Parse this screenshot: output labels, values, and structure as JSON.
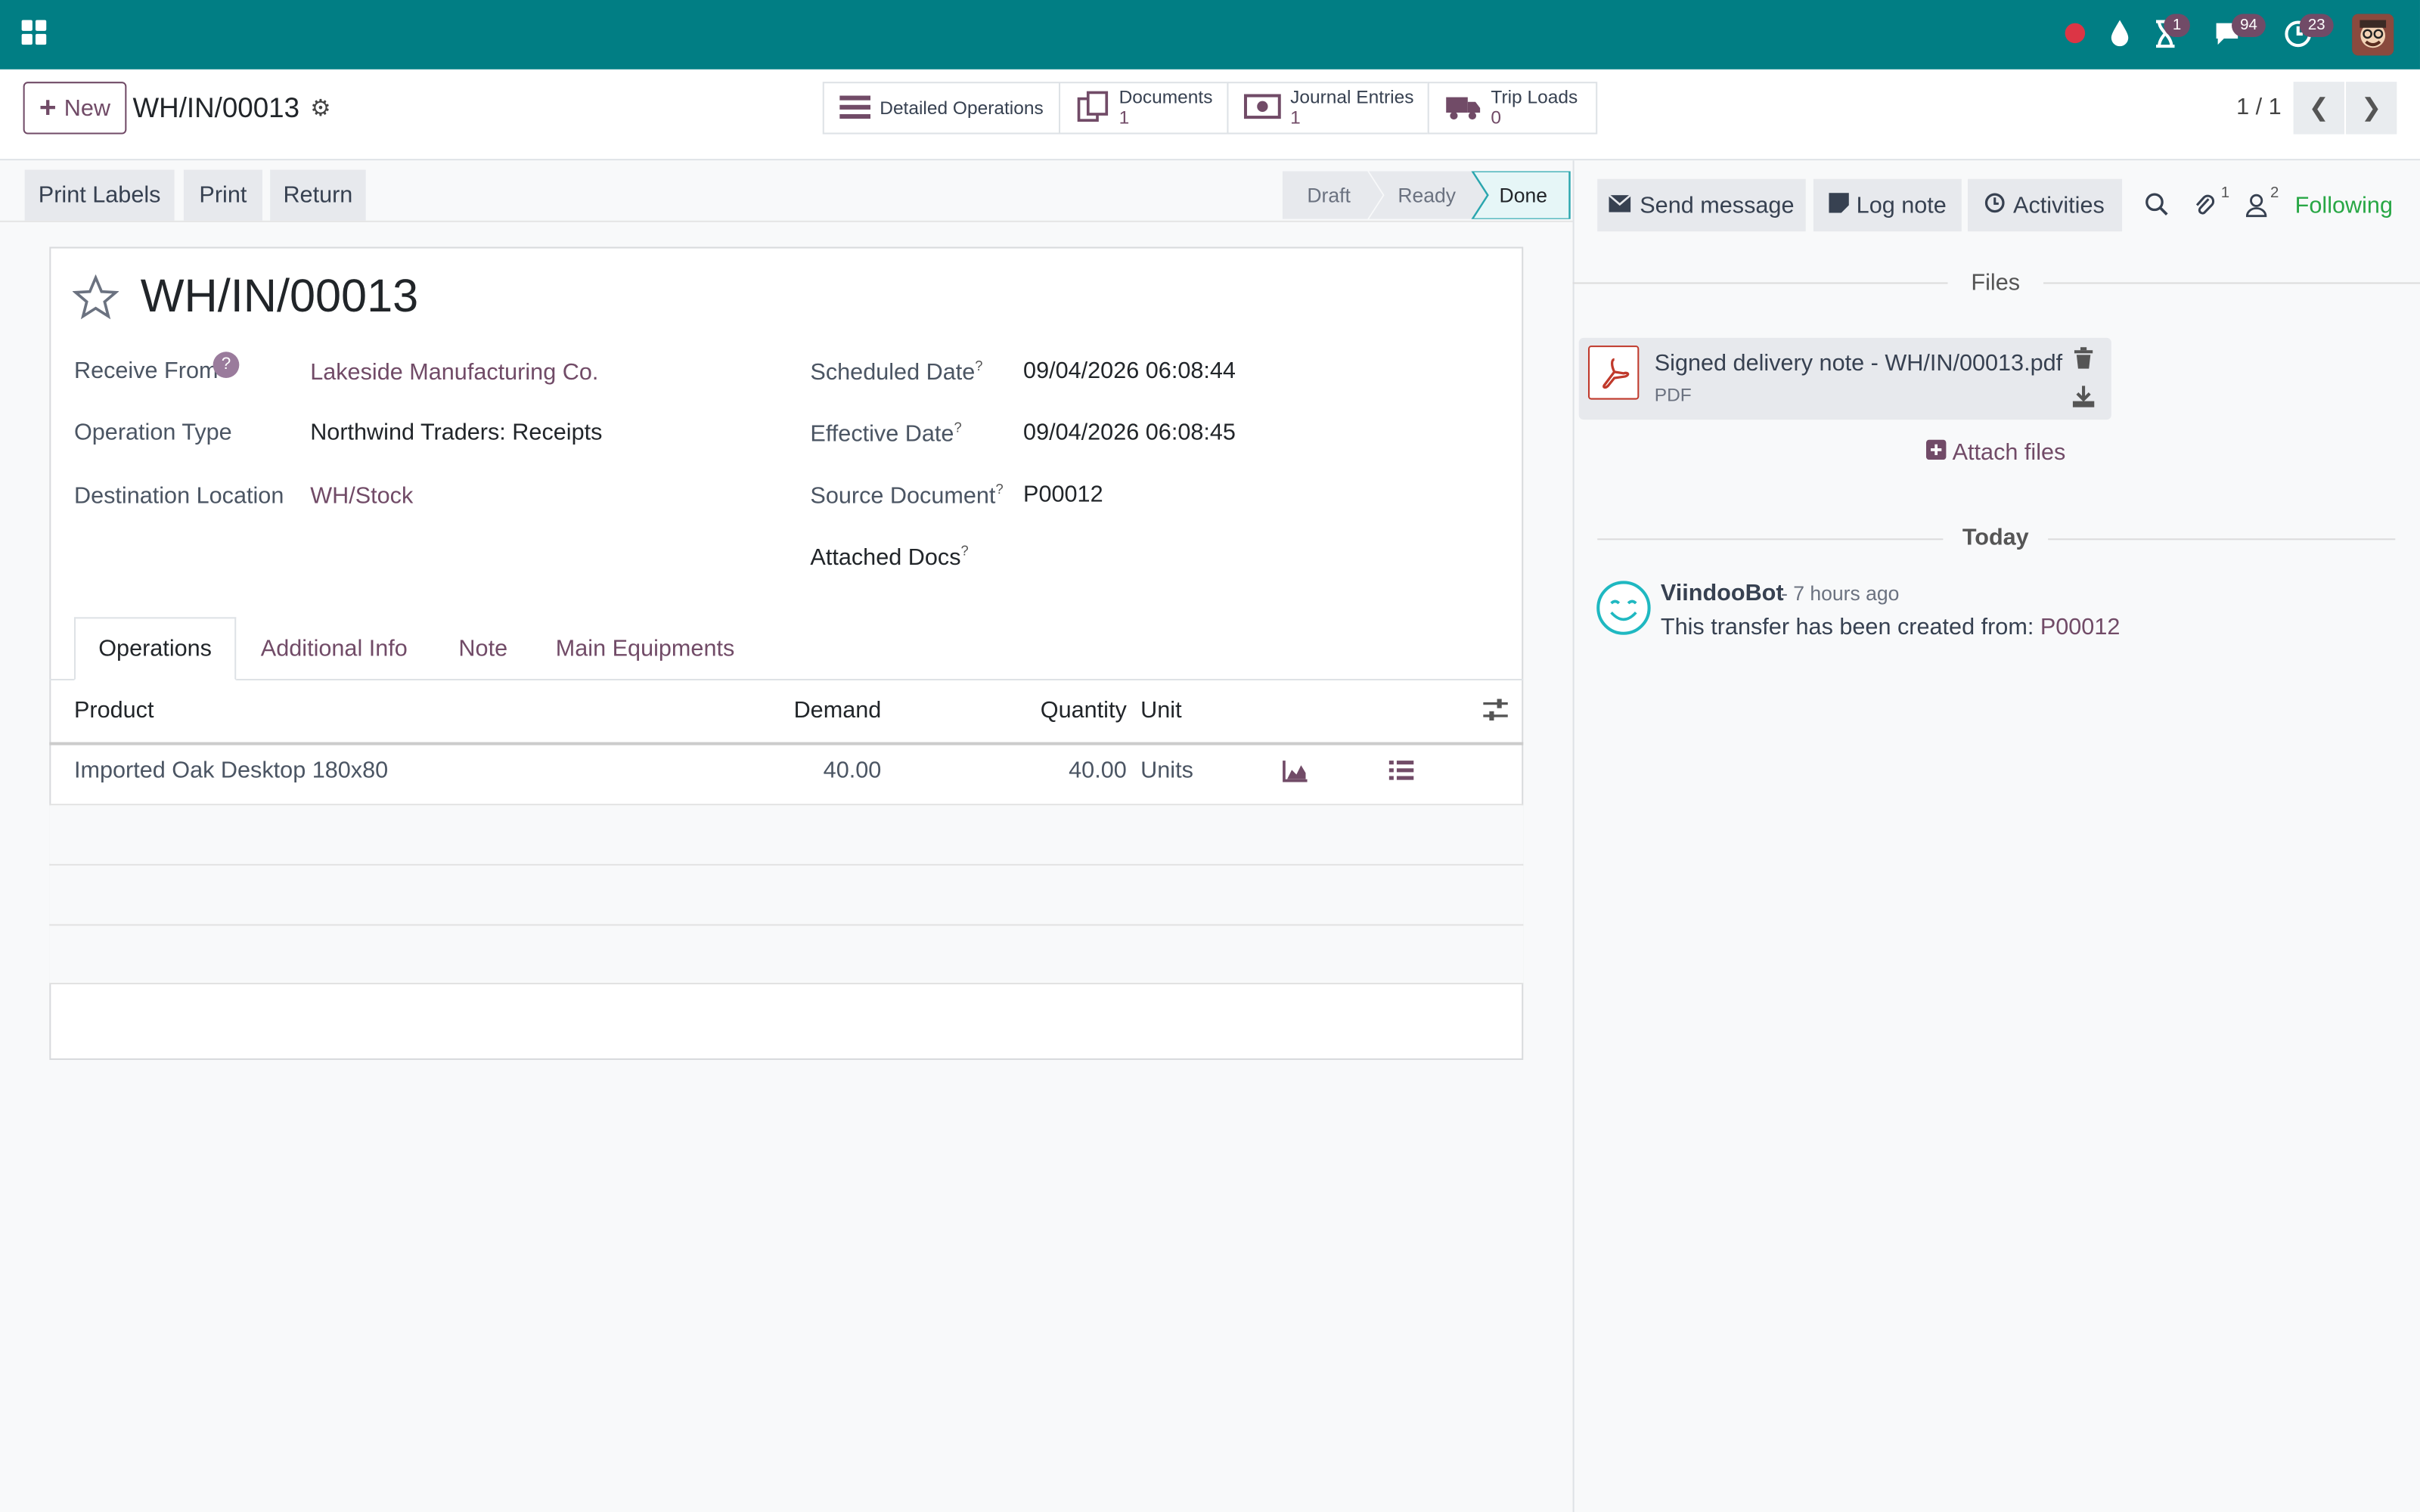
{
  "topbar": {
    "activity_badge": "1",
    "chat_badge": "94",
    "clock_badge": "23",
    "brand_color": "#017e84",
    "accent_color": "#714b67"
  },
  "control_panel": {
    "new_label": "New",
    "breadcrumb": "WH/IN/00013",
    "smart_buttons": [
      {
        "label": "Detailed Operations",
        "count": ""
      },
      {
        "label": "Documents",
        "count": "1"
      },
      {
        "label": "Journal Entries",
        "count": "1"
      },
      {
        "label": "Trip Loads",
        "count": "0"
      }
    ],
    "pager": "1 / 1"
  },
  "status_bar": {
    "actions": [
      "Print Labels",
      "Print",
      "Return"
    ],
    "stages": [
      "Draft",
      "Ready",
      "Done"
    ],
    "active_stage": "Done"
  },
  "form": {
    "title": "WH/IN/00013",
    "receive_from_label": "Receive From",
    "receive_from_value": "Lakeside Manufacturing Co.",
    "operation_type_label": "Operation Type",
    "operation_type_value": "Northwind Traders: Receipts",
    "destination_label": "Destination Location",
    "destination_value": "WH/Stock",
    "scheduled_label": "Scheduled Date",
    "scheduled_value": "09/04/2026 06:08:44",
    "effective_label": "Effective Date",
    "effective_value": "09/04/2026 06:08:45",
    "source_label": "Source Document",
    "source_value": "P00012",
    "attached_label": "Attached Docs",
    "help_mark": "?"
  },
  "tabs": [
    "Operations",
    "Additional Info",
    "Note",
    "Main Equipments"
  ],
  "table": {
    "headers": {
      "product": "Product",
      "demand": "Demand",
      "quantity": "Quantity",
      "unit": "Unit"
    },
    "rows": [
      {
        "product": "Imported Oak Desktop 180x80",
        "demand": "40.00",
        "quantity": "40.00",
        "unit": "Units"
      }
    ]
  },
  "chatter": {
    "send_message": "Send message",
    "log_note": "Log note",
    "activities": "Activities",
    "attachments_count": "1",
    "followers_count": "2",
    "following": "Following",
    "files_heading": "Files",
    "file_name": "Signed delivery note - WH/IN/00013.pdf",
    "file_type": "PDF",
    "attach_files": "Attach files",
    "today": "Today",
    "author": "ViindooBot",
    "time": "- 7 hours ago",
    "message": "This transfer has been created from:",
    "message_link": "P00012"
  }
}
